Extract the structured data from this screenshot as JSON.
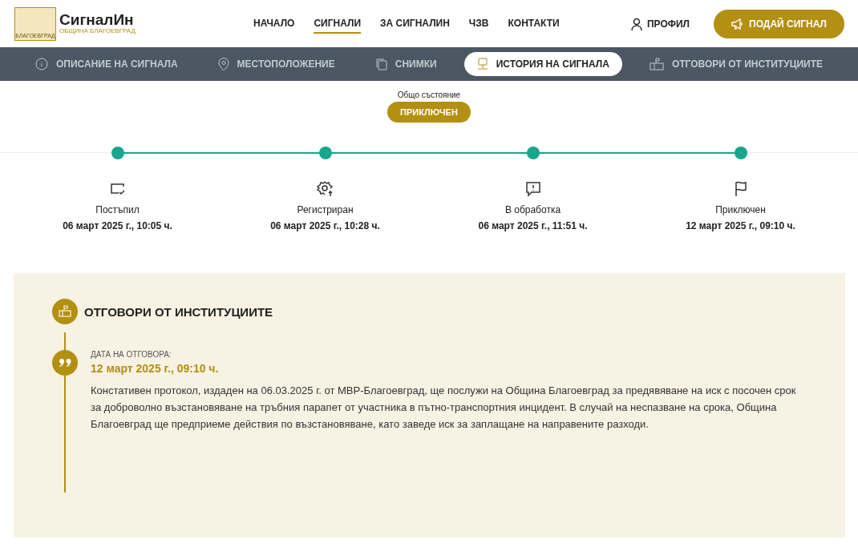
{
  "logo": {
    "title": "СигналИн",
    "subtitle": "ОБЩИНА БЛАГОЕВГРАД",
    "emblem_caption": "БЛАГОЕВГРАД"
  },
  "main_nav": [
    {
      "label": "НАЧАЛО",
      "selected": false
    },
    {
      "label": "СИГНАЛИ",
      "selected": true
    },
    {
      "label": "ЗА СИГНАЛИН",
      "selected": false
    },
    {
      "label": "ЧЗВ",
      "selected": false
    },
    {
      "label": "КОНТАКТИ",
      "selected": false
    }
  ],
  "profile_link": "ПРОФИЛ",
  "submit_button": "ПОДАЙ СИГНАЛ",
  "tabs": [
    {
      "label": "ОПИСАНИЕ НА СИГНАЛА",
      "kind": "info",
      "selected": false
    },
    {
      "label": "МЕСТОПОЛОЖЕНИЕ",
      "kind": "location",
      "selected": false
    },
    {
      "label": "СНИМКИ",
      "kind": "photos",
      "selected": false
    },
    {
      "label": "ИСТОРИЯ НА СИГНАЛА",
      "kind": "history",
      "selected": true
    },
    {
      "label": "ОТГОВОРИ ОТ ИНСТИТУЦИИТЕ",
      "kind": "mailbox",
      "selected": false
    }
  ],
  "overall_status": {
    "label": "Общо състояние",
    "value": "ПРИКЛЮЧЕН"
  },
  "timeline": [
    {
      "kind": "received",
      "label": "Постъпил",
      "date": "06 март 2025 г., 10:05 ч."
    },
    {
      "kind": "registered",
      "label": "Регистриран",
      "date": "06 март 2025 г., 10:28 ч."
    },
    {
      "kind": "processing",
      "label": "В обработка",
      "date": "06 март 2025 г., 11:51 ч."
    },
    {
      "kind": "closed",
      "label": "Приключен",
      "date": "12 март 2025 г., 09:10 ч."
    }
  ],
  "responses": {
    "title": "ОТГОВОРИ ОТ ИНСТИТУЦИИТЕ",
    "items": [
      {
        "date_label": "ДАТА НА ОТГОВОРА:",
        "date": "12 март 2025 г., 09:10 ч.",
        "text": "Констативен протокол, издаден на 06.03.2025 г. от МВР-Благоевград, ще послужи на Община Благоевград за предявяване на иск с посочен срок за доброволно възстановяване на тръбния парапет от участника в пътно-транспортния инцидент. В случай на неспазване на срока, Община Благоевград ще предприеме действия по възстановяване, като заведе иск за заплащане на направените разходи."
      }
    ]
  }
}
